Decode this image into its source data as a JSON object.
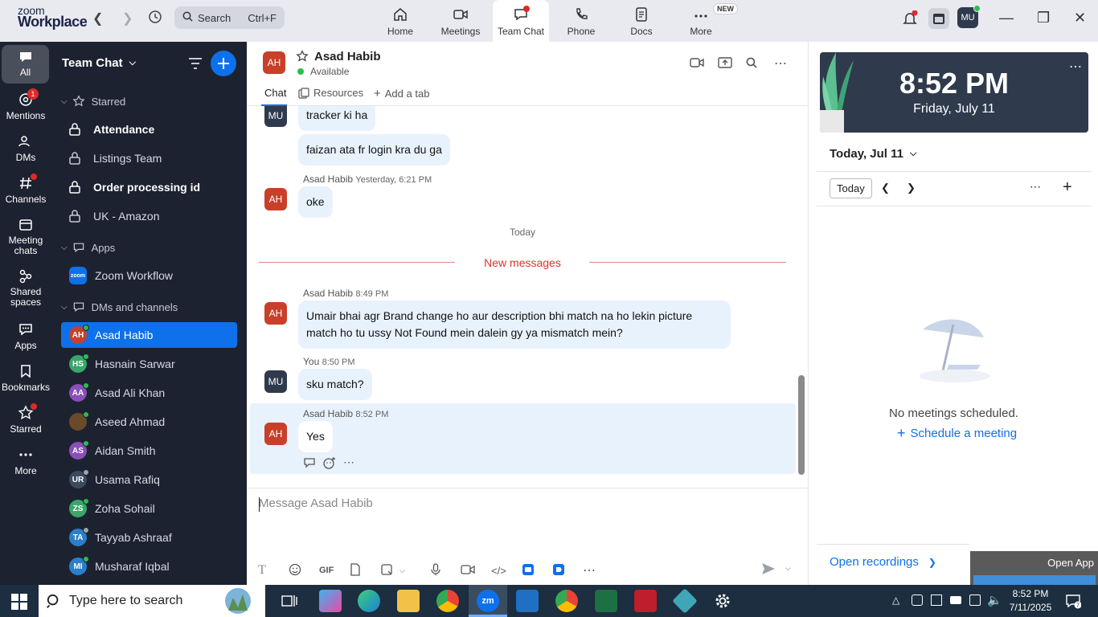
{
  "topbar": {
    "logo_line1": "zoom",
    "logo_line2": "Workplace",
    "search_label": "Search",
    "search_shortcut": "Ctrl+F",
    "tabs": [
      {
        "label": "Home"
      },
      {
        "label": "Meetings"
      },
      {
        "label": "Team Chat"
      },
      {
        "label": "Phone"
      },
      {
        "label": "Docs"
      },
      {
        "label": "More"
      }
    ],
    "new_badge": "NEW",
    "user_initials": "MU"
  },
  "rail": [
    {
      "label": "All"
    },
    {
      "label": "Mentions",
      "badge": "1"
    },
    {
      "label": "DMs"
    },
    {
      "label": "Channels"
    },
    {
      "label": "Meeting chats"
    },
    {
      "label": "Shared spaces"
    },
    {
      "label": "Apps"
    },
    {
      "label": "Bookmarks"
    },
    {
      "label": "Starred"
    },
    {
      "label": "More"
    }
  ],
  "sidebar": {
    "title": "Team Chat",
    "starred_label": "Starred",
    "starred_items": [
      "Attendance",
      "Listings Team",
      "Order processing id",
      "UK - Amazon"
    ],
    "apps_label": "Apps",
    "zoom_workflow": "Zoom Workflow",
    "zoom_badge": "zoom",
    "dms_label": "DMs and channels",
    "contacts": [
      {
        "initials": "AH",
        "name": "Asad Habib",
        "color": "#c8402a"
      },
      {
        "initials": "HS",
        "name": "Hasnain Sarwar",
        "color": "#3aa66a"
      },
      {
        "initials": "AA",
        "name": "Asad Ali Khan",
        "color": "#8a4fb8"
      },
      {
        "initials": "",
        "name": "Aseed Ahmad",
        "color": "#6b4a2a"
      },
      {
        "initials": "AS",
        "name": "Aidan Smith",
        "color": "#8a4fb8"
      },
      {
        "initials": "UR",
        "name": "Usama Rafiq",
        "color": "#3b4a5e"
      },
      {
        "initials": "ZS",
        "name": "Zoha Sohail",
        "color": "#3aa66a"
      },
      {
        "initials": "TA",
        "name": "Tayyab Ashraaf",
        "color": "#2a7fc8"
      },
      {
        "initials": "MI",
        "name": "Musharaf Iqbal",
        "color": "#2a7fc8"
      }
    ]
  },
  "chat": {
    "contact_initials": "AH",
    "contact_name": "Asad Habib",
    "status": "Available",
    "tabs": {
      "chat": "Chat",
      "resources": "Resources",
      "add": "Add a tab"
    },
    "messages": {
      "m1": "tracker ki ha",
      "m2": "faizan ata fr login kra du ga",
      "s3_name": "Asad Habib",
      "s3_time": "Yesterday, 6:21 PM",
      "m3": "oke",
      "today": "Today",
      "new_messages": "New messages",
      "s4_name": "Asad Habib",
      "s4_time": "8:49 PM",
      "m4": "Umair bhai agr Brand change ho aur description bhi match na ho lekin picture match ho tu ussy Not Found mein dalein gy ya mismatch mein?",
      "s5_name": "You",
      "s5_time": "8:50 PM",
      "m5": "sku match?",
      "s6_name": "Asad Habib",
      "s6_time": "8:52 PM",
      "m6": "Yes"
    },
    "my_initials": "MU",
    "composer_placeholder": "Message Asad Habib",
    "gif_label": "GIF"
  },
  "right": {
    "time": "8:52 PM",
    "date": "Friday, July 11",
    "today_header": "Today, Jul 11",
    "today_button": "Today",
    "no_meetings": "No meetings scheduled.",
    "schedule": "Schedule a meeting",
    "open_recordings": "Open recordings",
    "open_app": "Open App"
  },
  "taskbar": {
    "search_placeholder": "Type here to search",
    "time": "8:52 PM",
    "date": "7/11/2025",
    "zoom_label": "zm"
  },
  "colors": {
    "accent": "#0e71eb",
    "sidebar": "#1d2231",
    "bubble": "#e8f2fd",
    "new_messages": "#d9342b"
  }
}
